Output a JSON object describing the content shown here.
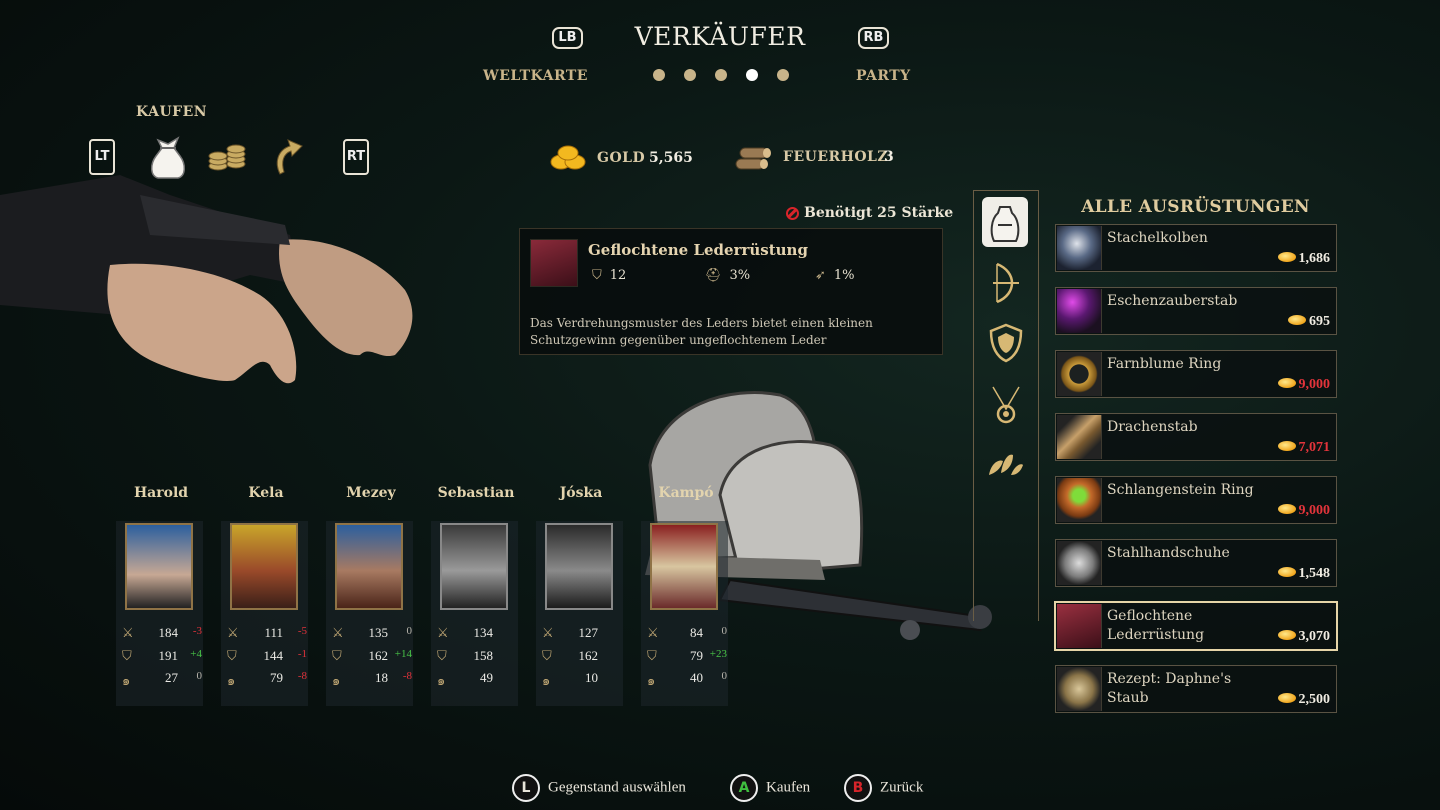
{
  "header": {
    "title": "VERKÄUFER",
    "lb": "LB",
    "rb": "RB",
    "left_tab": "WELTKARTE",
    "right_tab": "PARTY",
    "page_dots": 5,
    "active_dot": 4
  },
  "shop_mode": {
    "label": "KAUFEN",
    "lt": "LT",
    "rt": "RT",
    "icons": [
      "sack-icon",
      "coins-icon",
      "return-arrow-icon"
    ]
  },
  "currency": {
    "gold_label": "GOLD",
    "gold_value": "5,565",
    "wood_label": "FEUERHOLZ",
    "wood_value": "3"
  },
  "requirement": "Benötigt 25 Stärke",
  "item": {
    "name": "Geflochtene Lederrüstung",
    "armor": "12",
    "stat2": "3%",
    "stat3": "1%",
    "description": "Das Verdrehungsmuster des Leders bietet einen kleinen Schutzgewinn gegenüber ungeflochtenem Leder"
  },
  "party": [
    {
      "name": "Harold",
      "atk": "184",
      "atk_d": "-3",
      "def": "191",
      "def_d": "+4",
      "mag": "27",
      "mag_d": "0"
    },
    {
      "name": "Kela",
      "atk": "111",
      "atk_d": "-5",
      "def": "144",
      "def_d": "-1",
      "mag": "79",
      "mag_d": "-8"
    },
    {
      "name": "Mezey",
      "atk": "135",
      "atk_d": "0",
      "def": "162",
      "def_d": "+14",
      "mag": "18",
      "mag_d": "-8"
    },
    {
      "name": "Sebastian",
      "atk": "134",
      "atk_d": "",
      "def": "158",
      "def_d": "",
      "mag": "49",
      "mag_d": ""
    },
    {
      "name": "Jóska",
      "atk": "127",
      "atk_d": "",
      "def": "162",
      "def_d": "",
      "mag": "10",
      "mag_d": ""
    },
    {
      "name": "Kampó",
      "atk": "84",
      "atk_d": "0",
      "def": "79",
      "def_d": "+23",
      "mag": "40",
      "mag_d": "0"
    }
  ],
  "store": {
    "heading": "ALLE AUSRÜSTUNGEN",
    "categories": [
      "backpack-icon",
      "bow-icon",
      "shield-icon",
      "amulet-icon",
      "leaves-icon"
    ],
    "items": [
      {
        "name": "Stachelkolben",
        "price": "1,686",
        "affordable": true
      },
      {
        "name": "Eschenzauberstab",
        "price": "695",
        "affordable": true
      },
      {
        "name": "Farnblume Ring",
        "price": "9,000",
        "affordable": false
      },
      {
        "name": "Drachenstab",
        "price": "7,071",
        "affordable": false
      },
      {
        "name": "Schlangenstein Ring",
        "price": "9,000",
        "affordable": false
      },
      {
        "name": "Stahlhandschuhe",
        "price": "1,548",
        "affordable": true
      },
      {
        "name": "Geflochtene Lederrüstung",
        "price": "3,070",
        "affordable": true
      },
      {
        "name": "Rezept: Daphne's Staub",
        "price": "2,500",
        "affordable": true
      }
    ]
  },
  "footer": {
    "l_key": "L",
    "l_text": "Gegenstand auswählen",
    "a_key": "A",
    "a_text": "Kaufen",
    "b_key": "B",
    "b_text": "Zurück",
    "a_color": "#3fbf3f",
    "b_color": "#d8242a"
  }
}
